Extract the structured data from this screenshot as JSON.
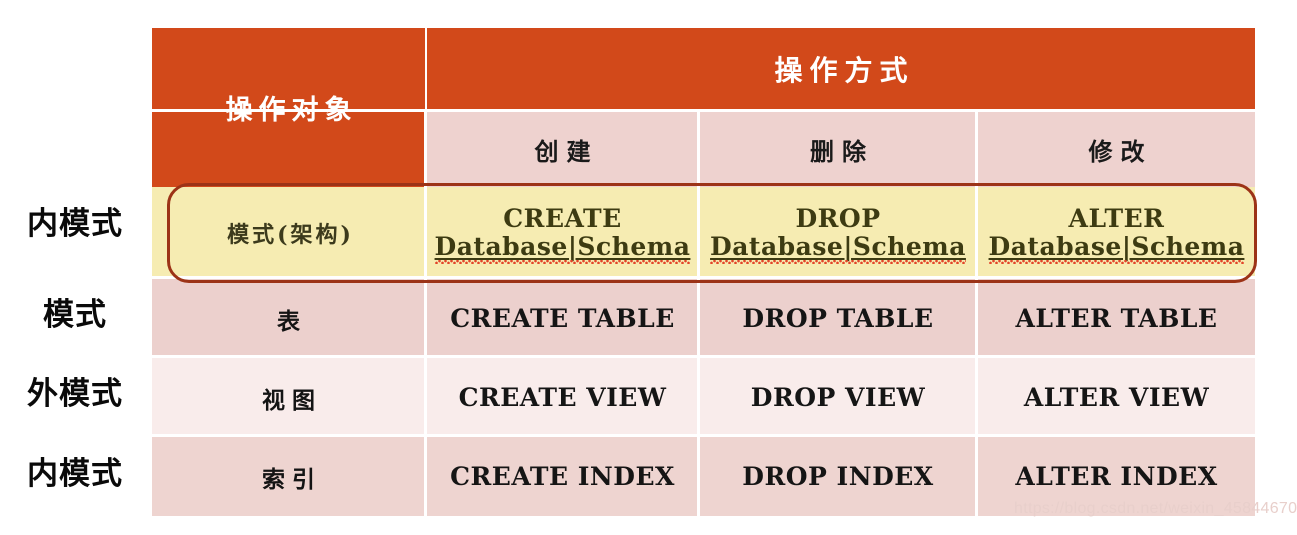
{
  "annotations": [
    {
      "label": "内模式"
    },
    {
      "label": "模式"
    },
    {
      "label": "外模式"
    },
    {
      "label": "内模式"
    }
  ],
  "table": {
    "header": {
      "object_col": "操作对象",
      "method_group": "操作方式",
      "sub_headers": [
        "创建",
        "删除",
        "修改"
      ]
    },
    "rows": [
      {
        "object": "模式(架构)",
        "highlighted": true,
        "cells": [
          {
            "line1": "CREATE",
            "line2": "Database|Schema"
          },
          {
            "line1": "DROP",
            "line2": "Database|Schema"
          },
          {
            "line1": "ALTER",
            "line2": "Database|Schema"
          }
        ]
      },
      {
        "object": "表",
        "highlighted": false,
        "cells": [
          {
            "line1": "CREATE TABLE",
            "line2": ""
          },
          {
            "line1": "DROP TABLE",
            "line2": ""
          },
          {
            "line1": "ALTER TABLE",
            "line2": ""
          }
        ]
      },
      {
        "object": "视图",
        "highlighted": false,
        "cells": [
          {
            "line1": "CREATE VIEW",
            "line2": ""
          },
          {
            "line1": "DROP VIEW",
            "line2": ""
          },
          {
            "line1": "ALTER VIEW",
            "line2": ""
          }
        ]
      },
      {
        "object": "索引",
        "highlighted": false,
        "cells": [
          {
            "line1": "CREATE INDEX",
            "line2": ""
          },
          {
            "line1": "DROP INDEX",
            "line2": ""
          },
          {
            "line1": "ALTER INDEX",
            "line2": ""
          }
        ]
      }
    ]
  },
  "watermark": "https://blog.csdn.net/weixin_45844670",
  "colors": {
    "header_orange": "#d2491a",
    "subheader_pink": "#eed2cf",
    "highlight_yellow": "#f6ecb2",
    "row_pink_dark": "#ecd0cd",
    "row_pink_light": "#f9eceb",
    "highlight_border": "#9c3317",
    "spellcheck_red": "#e2452a"
  }
}
